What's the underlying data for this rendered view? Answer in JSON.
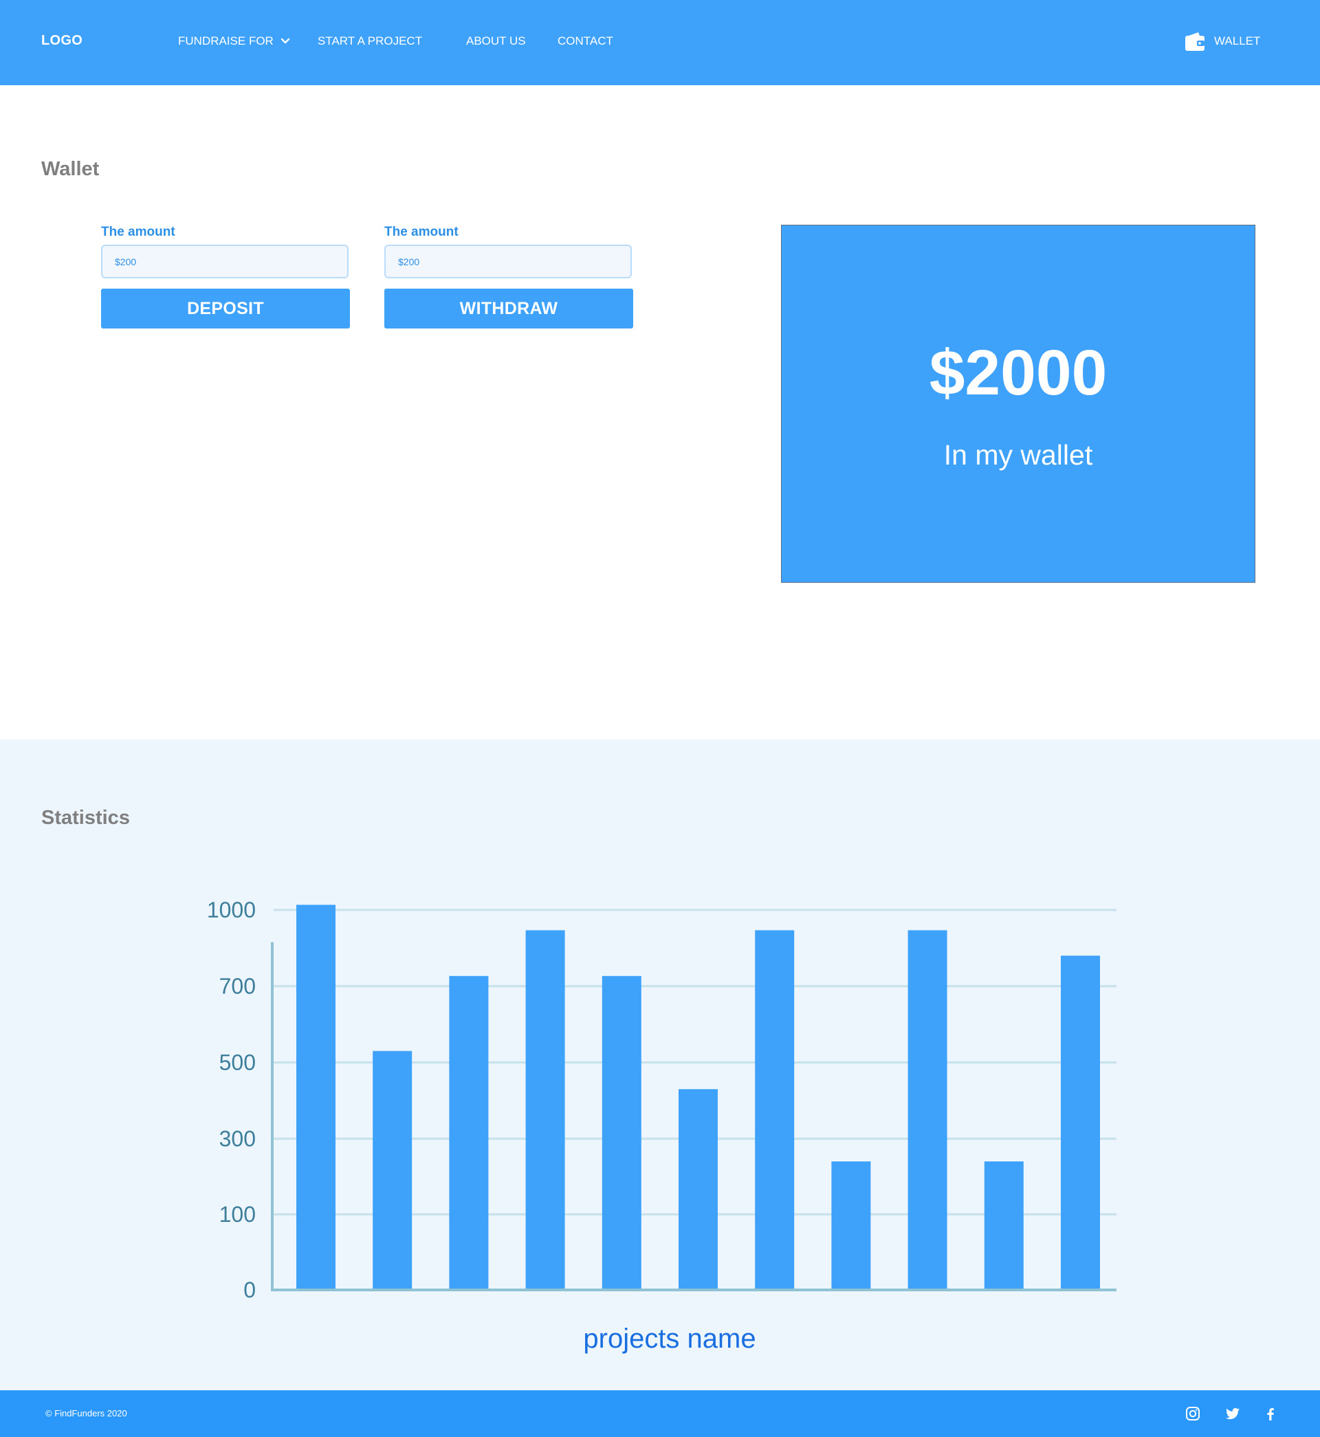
{
  "header": {
    "logo": "LOGO",
    "nav": [
      {
        "label": "FUNDRAISE FOR",
        "has_dropdown": true
      },
      {
        "label": "START A PROJECT"
      },
      {
        "label": "ABOUT US"
      },
      {
        "label": "CONTACT"
      }
    ],
    "wallet_label": "WALLET",
    "wallet_icon": "wallet-icon"
  },
  "wallet": {
    "title": "Wallet",
    "deposit": {
      "label": "The amount",
      "placeholder": "$200",
      "button": "DEPOSIT"
    },
    "withdraw": {
      "label": "The amount",
      "placeholder": "$200",
      "button": "WITHDRAW"
    },
    "balance": {
      "amount": "$2000",
      "caption": "In my wallet"
    }
  },
  "statistics": {
    "title": "Statistics"
  },
  "chart_data": {
    "type": "bar",
    "xlabel": "projects name",
    "ylabel": "",
    "yticks": [
      0,
      100,
      300,
      500,
      700,
      1000
    ],
    "ylim": [
      0,
      1000
    ],
    "grid": true,
    "values": [
      1020,
      530,
      740,
      920,
      740,
      430,
      920,
      240,
      920,
      240,
      820
    ]
  },
  "footer": {
    "copyright": "© FindFunders 2020",
    "social": [
      "instagram-icon",
      "twitter-icon",
      "facebook-icon"
    ]
  },
  "colors": {
    "primary": "#3ea2fa",
    "footer": "#2a97fb",
    "stats_background": "#eef6fd",
    "axis": "#8fc3d3",
    "tick_text": "#3d7f9a",
    "xlabel_text": "#1a6fe0",
    "title_text": "#7f7f7f"
  }
}
